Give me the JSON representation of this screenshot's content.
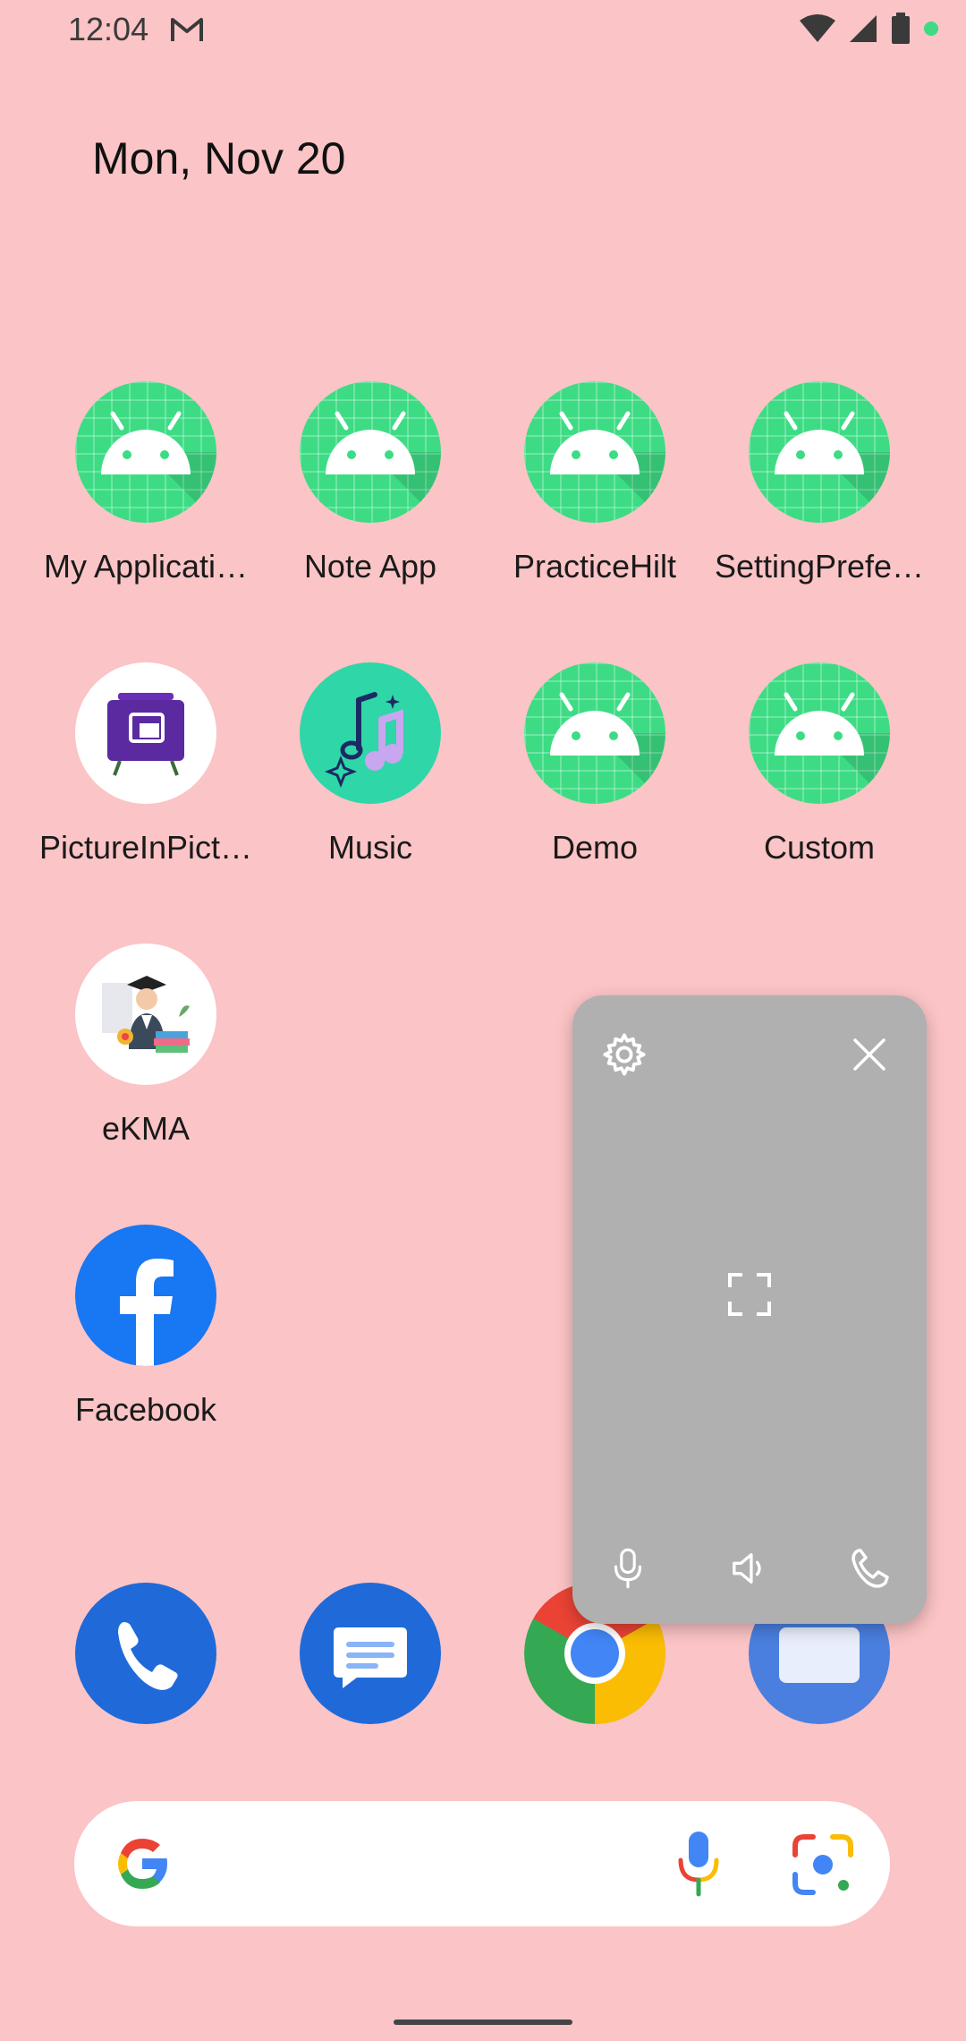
{
  "status_bar": {
    "time": "12:04",
    "notification_icons": [
      "gmail-icon"
    ],
    "system_icons": [
      "wifi-icon",
      "cell-signal-icon",
      "battery-icon",
      "privacy-dot-icon"
    ]
  },
  "date": "Mon, Nov 20",
  "apps": [
    {
      "label": "My Applicati…",
      "icon": "android-icon"
    },
    {
      "label": "Note App",
      "icon": "android-icon"
    },
    {
      "label": "PracticeHilt",
      "icon": "android-icon"
    },
    {
      "label": "SettingPrefe…",
      "icon": "android-icon"
    },
    {
      "label": "PictureInPict…",
      "icon": "picture-in-picture-icon"
    },
    {
      "label": "Music",
      "icon": "music-icon"
    },
    {
      "label": "Demo",
      "icon": "android-icon"
    },
    {
      "label": "Custom",
      "icon": "android-icon"
    },
    {
      "label": "eKMA",
      "icon": "graduate-icon"
    },
    {
      "label": "Facebook",
      "icon": "facebook-icon"
    }
  ],
  "floating_panel": {
    "top_icons": [
      "gear-icon",
      "close-icon"
    ],
    "center_icon": "fullscreen-icon",
    "bottom_icons": [
      "microphone-icon",
      "speaker-icon",
      "phone-icon"
    ]
  },
  "dock": [
    "phone-app-icon",
    "messages-app-icon",
    "chrome-app-icon",
    "camera-app-icon"
  ],
  "search": {
    "icons": [
      "google-g-icon",
      "google-mic-icon",
      "google-lens-icon"
    ]
  },
  "colors": {
    "wallpaper": "#fbc4c6",
    "android_green": "#3ddc84",
    "panel_gray": "#b0b0b0",
    "facebook_blue": "#1877f2"
  }
}
